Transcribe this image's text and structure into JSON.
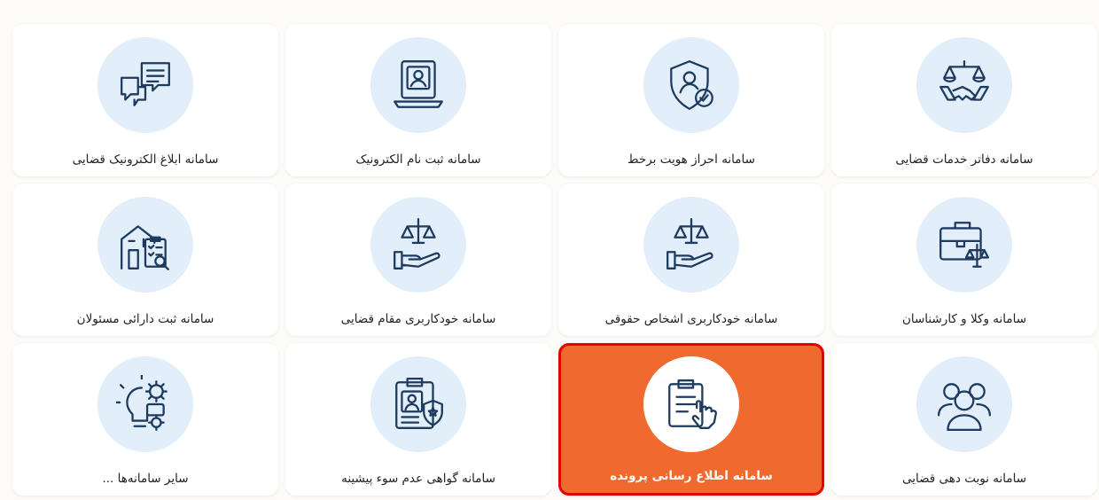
{
  "services": [
    {
      "label": "سامانه دفاتر خدمات قضایی",
      "icon": "handshake-scales-icon",
      "active": false
    },
    {
      "label": "سامانه احراز هویت برخط",
      "icon": "shield-user-check-icon",
      "active": false
    },
    {
      "label": "سامانه ثبت نام الکترونیک",
      "icon": "laptop-user-icon",
      "active": false
    },
    {
      "label": "سامانه ابلاغ الکترونیک قضایی",
      "icon": "chat-bubbles-icon",
      "active": false
    },
    {
      "label": "سامانه وکلا و کارشناسان",
      "icon": "briefcase-scales-icon",
      "active": false
    },
    {
      "label": "سامانه خودکاربری اشخاص حقوقی",
      "icon": "hand-scales-icon",
      "active": false
    },
    {
      "label": "سامانه خودکاربری مقام قضایی",
      "icon": "hand-scales-icon",
      "active": false
    },
    {
      "label": "سامانه ثبت دارائی مسئولان",
      "icon": "building-checklist-icon",
      "active": false
    },
    {
      "label": "سامانه نوبت دهی قضایی",
      "icon": "user-group-icon",
      "active": false
    },
    {
      "label": "سامانه اطلاع رسانی پرونده",
      "icon": "clipboard-hand-icon",
      "active": true
    },
    {
      "label": "سامانه گواهی عدم سوء پیشینه",
      "icon": "clipboard-badge-icon",
      "active": false
    },
    {
      "label": "سایر سامانه‌ها ...",
      "icon": "lightbulb-gears-icon",
      "active": false
    }
  ],
  "colors": {
    "active_bg": "#f06a2f",
    "active_border": "#e60000",
    "circle_bg": "#e3eefb",
    "icon_stroke": "#1d3a5f"
  }
}
